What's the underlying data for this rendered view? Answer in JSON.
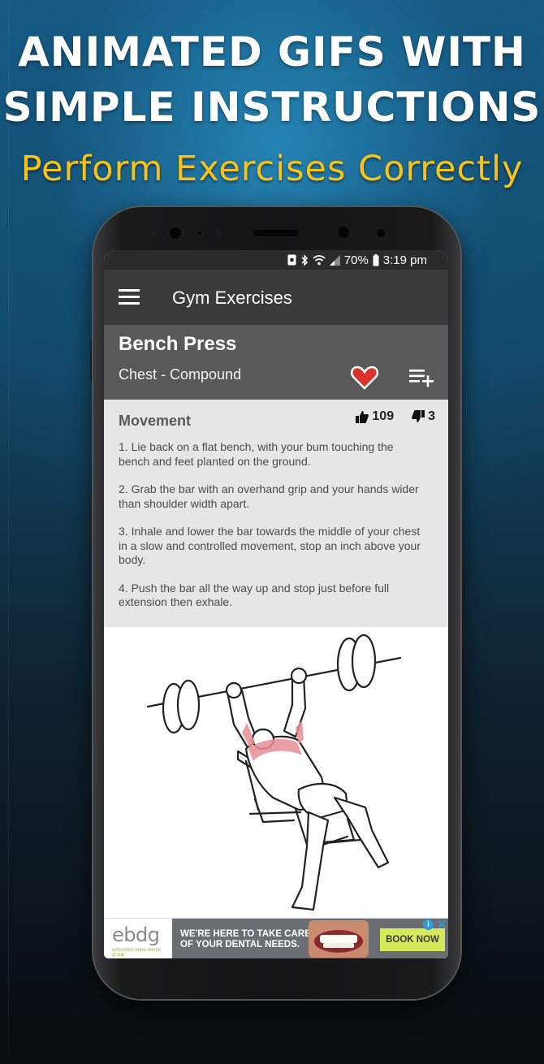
{
  "promo": {
    "headline_line1": "ANIMATED GIFS WITH",
    "headline_line2": "SIMPLE INSTRUCTIONS",
    "subheadline": "Perform Exercises Correctly",
    "colors": {
      "headline": "#ffffff",
      "subheadline": "#f6c21c",
      "background": "#16628c"
    }
  },
  "status_bar": {
    "battery": "70%",
    "time": "3:19 pm",
    "icons": [
      "screenshot-icon",
      "bluetooth-icon",
      "wifi-icon",
      "signal-icon",
      "battery-icon"
    ]
  },
  "toolbar": {
    "title": "Gym Exercises",
    "menu_icon": "hamburger-menu-icon"
  },
  "exercise": {
    "name": "Bench Press",
    "category": "Chest - Compound",
    "favorite_icon": "heart-icon",
    "add_to_list_icon": "playlist-add-icon",
    "favorite_color": "#d9332b"
  },
  "movement": {
    "title": "Movement",
    "likes": "109",
    "dislikes": "3",
    "steps": [
      "1. Lie back on a flat bench, with your bum touching the bench and feet planted on the ground.",
      "2. Grab the bar with an overhand grip and your hands wider than shoulder width apart.",
      "3. Inhale and lower the bar towards the middle of your chest in a slow and controlled movement, stop an inch above your body.",
      "4. Push the bar all the way up and stop just before full extension then exhale."
    ]
  },
  "ad": {
    "logo": "ebdg",
    "logo_sub": "edmonton bone dental group",
    "text": "WE'RE HERE TO TAKE CARE OF YOUR DENTAL NEEDS.",
    "cta": "BOOK NOW",
    "cta_color": "#d4ea5a"
  }
}
